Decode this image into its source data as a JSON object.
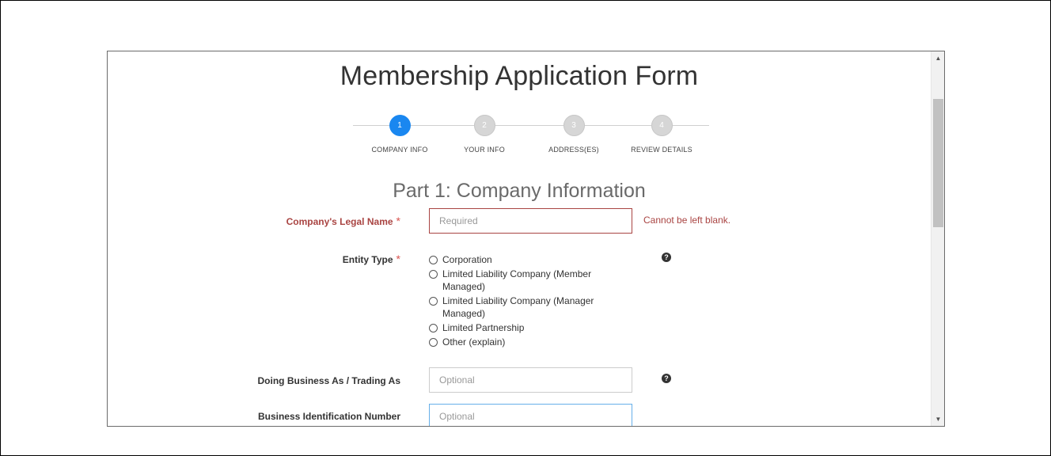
{
  "page": {
    "title": "Membership Application Form"
  },
  "stepper": {
    "steps": [
      {
        "number": "1",
        "label": "COMPANY INFO",
        "active": true
      },
      {
        "number": "2",
        "label": "YOUR INFO",
        "active": false
      },
      {
        "number": "3",
        "label": "ADDRESS(ES)",
        "active": false
      },
      {
        "number": "4",
        "label": "REVIEW DETAILS",
        "active": false
      }
    ],
    "active_color": "#1a87f0",
    "inactive_color": "#d6d6d6"
  },
  "section": {
    "title": "Part 1: Company Information"
  },
  "fields": {
    "legal_name": {
      "label": "Company's Legal Name",
      "required_mark": "*",
      "value": "",
      "placeholder": "Required",
      "error": "Cannot be left blank."
    },
    "entity_type": {
      "label": "Entity Type",
      "required_mark": "*",
      "options": [
        "Corporation",
        "Limited Liability Company (Member Managed)",
        "Limited Liability Company (Manager Managed)",
        "Limited Partnership",
        "Other (explain)"
      ],
      "help_icon": "question-circle-icon"
    },
    "dba": {
      "label": "Doing Business As / Trading As",
      "value": "",
      "placeholder": "Optional",
      "help_icon": "question-circle-icon"
    },
    "bin": {
      "label": "Business Identification Number",
      "value": "",
      "placeholder": "Optional"
    }
  },
  "colors": {
    "error": "#a94442",
    "focus_border": "#66afe9"
  }
}
